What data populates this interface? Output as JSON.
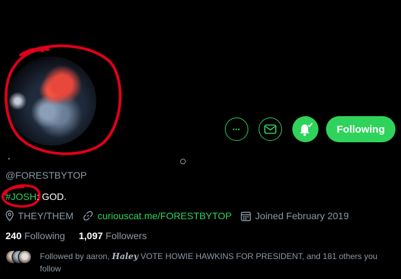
{
  "profile": {
    "display_mark": "﹐",
    "handle": "@FORESTBYTOP",
    "bio_tag": "#JOSH",
    "bio_text": ": GOD.",
    "location": "THEY/THEM",
    "website": "curiouscat.me/FORESTBYTOP",
    "joined": "Joined February 2019"
  },
  "stats": {
    "following_count": "240",
    "following_label": "Following",
    "followers_count": "1,097",
    "followers_label": "Followers"
  },
  "followed_by": {
    "prefix": "Followed by aaron, ",
    "name_styled": "Haley",
    "suffix": " VOTE HOWIE HAWKINS FOR PRESIDENT, and 181 others you follow"
  },
  "actions": {
    "more_glyph": "•••",
    "follow_label": "Following"
  },
  "colors": {
    "accent": "#2fd35c",
    "background": "#000000",
    "muted_text": "#8b98a5",
    "scribble": "#e0001b"
  },
  "icons": [
    "more-icon",
    "mail-icon",
    "bell-icon",
    "location-icon",
    "link-icon",
    "calendar-icon"
  ]
}
